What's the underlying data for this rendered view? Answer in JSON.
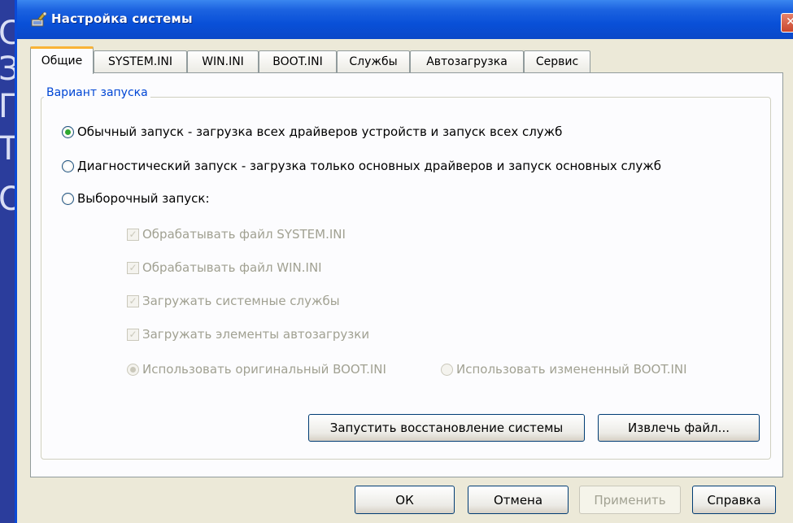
{
  "window": {
    "title": "Настройка системы",
    "close_glyph": "✕"
  },
  "tabs": [
    "Общие",
    "SYSTEM.INI",
    "WIN.INI",
    "BOOT.INI",
    "Службы",
    "Автозагрузка",
    "Сервис"
  ],
  "startup": {
    "group_label": "Вариант запуска",
    "normal": "Обычный запуск - загрузка всех драйверов устройств и запуск всех служб",
    "diagnostic": "Диагностический запуск - загрузка только основных драйверов и запуск основных служб",
    "selective": "Выборочный запуск:",
    "process_system_ini": "Обрабатывать файл SYSTEM.INI",
    "process_win_ini": "Обрабатывать файл WIN.INI",
    "load_services": "Загружать системные службы",
    "load_startup": "Загружать элементы автозагрузки",
    "use_original_boot": "Использовать оригинальный  BOOT.INI",
    "use_modified_boot": "Использовать измененный BOOT.INI",
    "selected_mode": "normal"
  },
  "buttons": {
    "restore": "Запустить восстановление системы",
    "extract": "Извлечь файл...",
    "ok": "ОК",
    "cancel": "Отмена",
    "apply": "Применить",
    "help": "Справка"
  },
  "background_letters": [
    "С",
    "З",
    "Г",
    "Т",
    "О"
  ],
  "colors": {
    "titlebar": "#0a4ad8",
    "group_label": "#0046d5",
    "active_tab_accent": "#f9b336",
    "radio_selected": "#2ea82e",
    "desktop": "#2b3d9c"
  }
}
